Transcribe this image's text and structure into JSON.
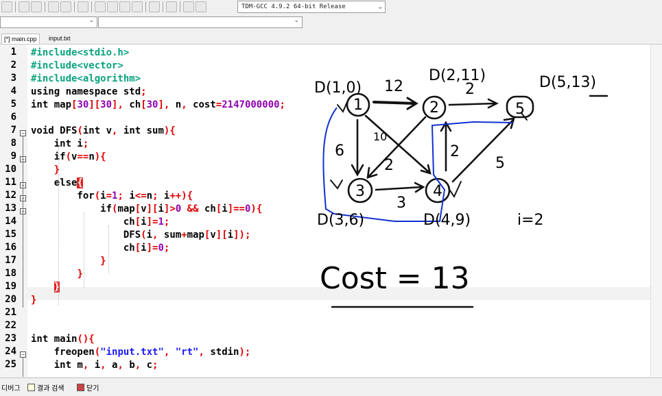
{
  "toolbar": {
    "compiler": "TDM-GCC 4.9.2 64-bit Release"
  },
  "tabs": [
    {
      "label": "[*] main.cpp"
    },
    {
      "label": "input.txt"
    }
  ],
  "code_lines": [
    {
      "n": "1",
      "html": "<span class='pp'>#include&lt;stdio.h&gt;</span>"
    },
    {
      "n": "2",
      "html": "<span class='pp'>#include&lt;vector&gt;</span>"
    },
    {
      "n": "3",
      "html": "<span class='pp'>#include&lt;algorithm&gt;</span>"
    },
    {
      "n": "4",
      "html": "using namespace std<span class='sym'>;</span>"
    },
    {
      "n": "5",
      "html": "int map<span class='sym'>[</span><span class='num'>30</span><span class='sym'>][</span><span class='num'>30</span><span class='sym'>],</span> ch<span class='sym'>[</span><span class='num'>30</span><span class='sym'>],</span> n<span class='sym'>,</span> cost<span class='sym'>=</span><span class='num'>2147000000</span><span class='sym'>;</span>"
    },
    {
      "n": "6",
      "html": ""
    },
    {
      "n": "7",
      "html": "void DFS<span class='sym'>(</span>int v<span class='sym'>,</span> int sum<span class='sym'>){</span>"
    },
    {
      "n": "8",
      "html": "    int i<span class='sym'>;</span>"
    },
    {
      "n": "9",
      "html": "    if<span class='sym'>(</span>v<span class='sym'>==</span>n<span class='sym'>){</span>"
    },
    {
      "n": "10",
      "html": "    <span class='sym'>}</span>"
    },
    {
      "n": "11",
      "html": "    else<span class='redbox'>{</span>"
    },
    {
      "n": "12",
      "html": "        for<span class='sym'>(</span>i<span class='sym'>=</span><span class='num'>1</span><span class='sym'>;</span> i<span class='sym'>&lt;=</span>n<span class='sym'>;</span> i<span class='sym'>++){</span>"
    },
    {
      "n": "13",
      "html": "            if<span class='sym'>(</span>map<span class='sym'>[</span>v<span class='sym'>][</span>i<span class='sym'>]&gt;</span><span class='num'>0</span> <span class='sym'>&amp;&amp;</span> ch<span class='sym'>[</span>i<span class='sym'>]==</span><span class='num'>0</span><span class='sym'>){</span>"
    },
    {
      "n": "14",
      "html": "                ch<span class='sym'>[</span>i<span class='sym'>]=</span><span class='num'>1</span><span class='sym'>;</span>"
    },
    {
      "n": "15",
      "html": "                DFS<span class='sym'>(</span>i<span class='sym'>,</span> sum<span class='sym'>+</span>map<span class='sym'>[</span>v<span class='sym'>][</span>i<span class='sym'>]);</span>"
    },
    {
      "n": "16",
      "html": "                ch<span class='sym'>[</span>i<span class='sym'>]=</span><span class='num'>0</span><span class='sym'>;</span>"
    },
    {
      "n": "17",
      "html": "            <span class='sym'>}</span>"
    },
    {
      "n": "18",
      "html": "        <span class='sym'>}</span>"
    },
    {
      "n": "19",
      "html": "    <span class='redbox'>}</span>"
    },
    {
      "n": "20",
      "html": "<span class='sym'>}</span>"
    },
    {
      "n": "21",
      "html": ""
    },
    {
      "n": "22",
      "html": ""
    },
    {
      "n": "23",
      "html": "int main<span class='sym'>(){</span>"
    },
    {
      "n": "24",
      "html": "    freopen<span class='sym'>(</span><span class='str'>\"input.txt\"</span><span class='sym'>,</span> <span class='str'>\"rt\"</span><span class='sym'>,</span> stdin<span class='sym'>);</span>"
    },
    {
      "n": "25",
      "html": "    int m<span class='sym'>,</span> i<span class='sym'>,</span> a<span class='sym'>,</span> b<span class='sym'>,</span> c<span class='sym'>;</span>"
    }
  ],
  "annotation": {
    "nodes": [
      {
        "id": "1",
        "dist": "D(1,0)"
      },
      {
        "id": "2",
        "dist": "D(2,11)"
      },
      {
        "id": "5",
        "dist": "D(5,13)"
      },
      {
        "id": "3",
        "dist": "D(3,6)"
      },
      {
        "id": "4",
        "dist": "D(4,9)"
      }
    ],
    "edge_weights": [
      "12",
      "2",
      "6",
      "10",
      "2",
      "2",
      "3",
      "5"
    ],
    "iter_note": "i=2",
    "cost_note": "Cost = 13"
  },
  "status": {
    "debug": "디버그",
    "search": "결과 검색",
    "close": "닫기"
  }
}
